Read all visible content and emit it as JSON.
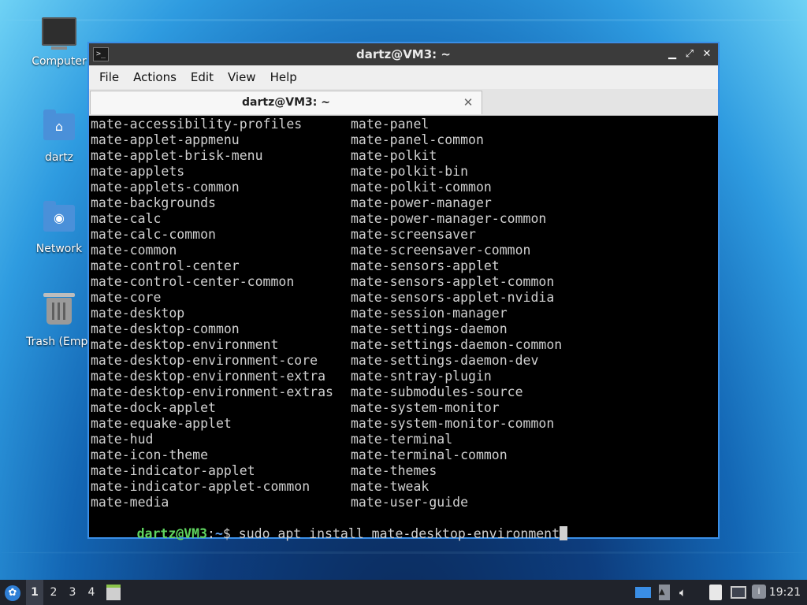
{
  "desktop": {
    "icons": [
      {
        "label": "Computer",
        "icon": "computer-icon"
      },
      {
        "label": "dartz",
        "icon": "home-folder-icon"
      },
      {
        "label": "Network",
        "icon": "network-folder-icon"
      },
      {
        "label": "Trash (Empt",
        "icon": "trash-icon"
      }
    ]
  },
  "window": {
    "title": "dartz@VM3: ~",
    "menu": [
      "File",
      "Actions",
      "Edit",
      "View",
      "Help"
    ],
    "tab_label": "dartz@VM3: ~"
  },
  "terminal": {
    "col1": [
      "mate-accessibility-profiles",
      "mate-applet-appmenu",
      "mate-applet-brisk-menu",
      "mate-applets",
      "mate-applets-common",
      "mate-backgrounds",
      "mate-calc",
      "mate-calc-common",
      "mate-common",
      "mate-control-center",
      "mate-control-center-common",
      "mate-core",
      "mate-desktop",
      "mate-desktop-common",
      "mate-desktop-environment",
      "mate-desktop-environment-core",
      "mate-desktop-environment-extra",
      "mate-desktop-environment-extras",
      "mate-dock-applet",
      "mate-equake-applet",
      "mate-hud",
      "mate-icon-theme",
      "mate-indicator-applet",
      "mate-indicator-applet-common",
      "mate-media"
    ],
    "col2": [
      "mate-panel",
      "mate-panel-common",
      "mate-polkit",
      "mate-polkit-bin",
      "mate-polkit-common",
      "mate-power-manager",
      "mate-power-manager-common",
      "mate-screensaver",
      "mate-screensaver-common",
      "mate-sensors-applet",
      "mate-sensors-applet-common",
      "mate-sensors-applet-nvidia",
      "mate-session-manager",
      "mate-settings-daemon",
      "mate-settings-daemon-common",
      "mate-settings-daemon-dev",
      "mate-sntray-plugin",
      "mate-submodules-source",
      "mate-system-monitor",
      "mate-system-monitor-common",
      "mate-terminal",
      "mate-terminal-common",
      "mate-themes",
      "mate-tweak",
      "mate-user-guide"
    ],
    "prompt_user": "dartz@VM3",
    "prompt_sep": ":",
    "prompt_path": "~",
    "prompt_symbol": "$",
    "command": " sudo apt install mate-desktop-environment"
  },
  "taskbar": {
    "workspaces": [
      "1",
      "2",
      "3",
      "4"
    ],
    "active_workspace": "1",
    "clock": "19:21",
    "tray_icons": [
      "desktop-switch-icon",
      "upload-icon",
      "volume-icon",
      "clipboard-icon",
      "network-icon",
      "update-notifier-icon"
    ]
  },
  "colors": {
    "window_border": "#3a8ee6",
    "prompt_user": "#5fd35f",
    "prompt_path": "#5c9ded",
    "taskbar_bg": "#20232b"
  }
}
